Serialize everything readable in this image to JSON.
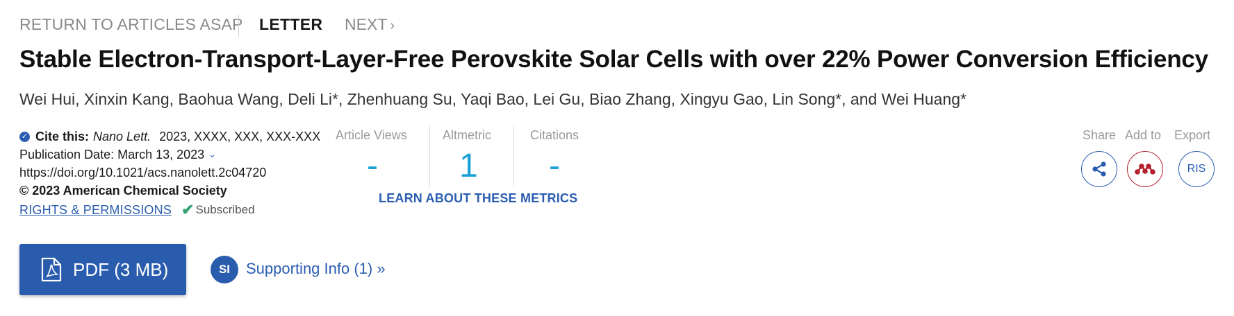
{
  "nav": {
    "return_label": "RETURN TO ARTICLES ASAP",
    "current_label": "LETTER",
    "next_label": "NEXT",
    "next_chevron": "›"
  },
  "article": {
    "title": "Stable Electron-Transport-Layer-Free Perovskite Solar Cells with over 22% Power Conversion Efficiency",
    "authors": [
      "Wei Hui",
      "Xinxin Kang",
      "Baohua Wang",
      "Deli Li*",
      "Zhenhuang Su",
      "Yaqi Bao",
      "Lei Gu",
      "Biao Zhang",
      "Xingyu Gao",
      "Lin Song*",
      "Wei Huang*"
    ],
    "authors_text": "Wei Hui, Xinxin Kang, Baohua Wang, Deli Li*, Zhenhuang Su, Yaqi Bao, Lei Gu, Biao Zhang, Xingyu Gao, Lin Song*, and Wei Huang*"
  },
  "cite": {
    "label": "Cite this:",
    "journal": "Nano Lett.",
    "ref": "2023, XXXX, XXX, XXX-XXX",
    "pub_date": "Publication Date: March 13, 2023",
    "doi": "https://doi.org/10.1021/acs.nanolett.2c04720",
    "copyright": "© 2023 American Chemical Society",
    "rights_label": "RIGHTS & PERMISSIONS",
    "subscribed_label": "Subscribed"
  },
  "metrics": {
    "views_label": "Article Views",
    "views_value": "-",
    "altmetric_label": "Altmetric",
    "altmetric_value": "1",
    "citations_label": "Citations",
    "citations_value": "-",
    "learn_label": "LEARN ABOUT THESE METRICS"
  },
  "actions": {
    "share_label": "Share",
    "add_label": "Add to",
    "export_label": "Export",
    "ris_label": "RIS"
  },
  "downloads": {
    "pdf_label": "PDF (3 MB)",
    "si_badge": "SI",
    "si_label": "Supporting Info (1) »"
  },
  "colors": {
    "accent_blue": "#2a5db0",
    "metric_blue": "#1a9fd6",
    "mendeley_red": "#b5202e",
    "subscribed_green": "#35a373"
  }
}
